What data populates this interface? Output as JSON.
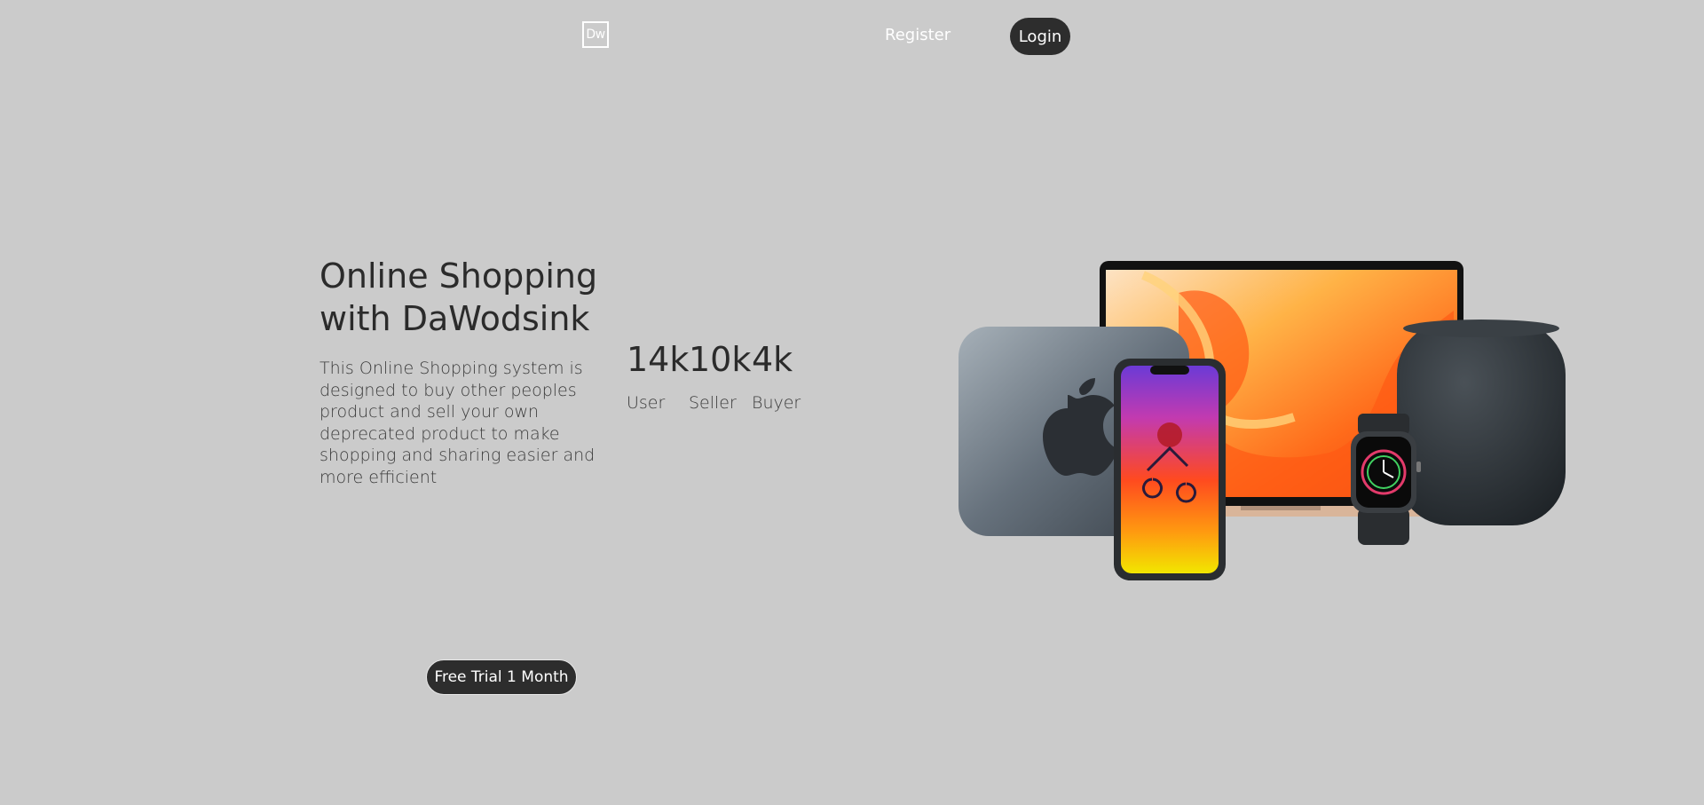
{
  "header": {
    "logo_text": "Dw",
    "register_label": "Register",
    "login_label": "Login"
  },
  "hero": {
    "title_line1": "Online Shopping",
    "title_line2": "with DaWodsink",
    "description": "This Online Shopping system is designed to buy other peoples product and sell your own deprecated product to make shopping and sharing easier and more efficient",
    "cta_label": "Free Trial 1 Month"
  },
  "stats": [
    {
      "value": "14k",
      "label": "User"
    },
    {
      "value": "10k",
      "label": "Seller"
    },
    {
      "value": "4k",
      "label": "Buyer"
    }
  ],
  "colors": {
    "background": "#cbcbcb",
    "button_dark": "#2d2d2d",
    "text_dark": "#2b2b2b",
    "white": "#ffffff"
  },
  "image": {
    "description_icon_names": [
      "mac-mini-icon",
      "macbook-icon",
      "iphone-icon",
      "apple-watch-icon",
      "homepod-icon",
      "apple-logo-icon"
    ]
  }
}
